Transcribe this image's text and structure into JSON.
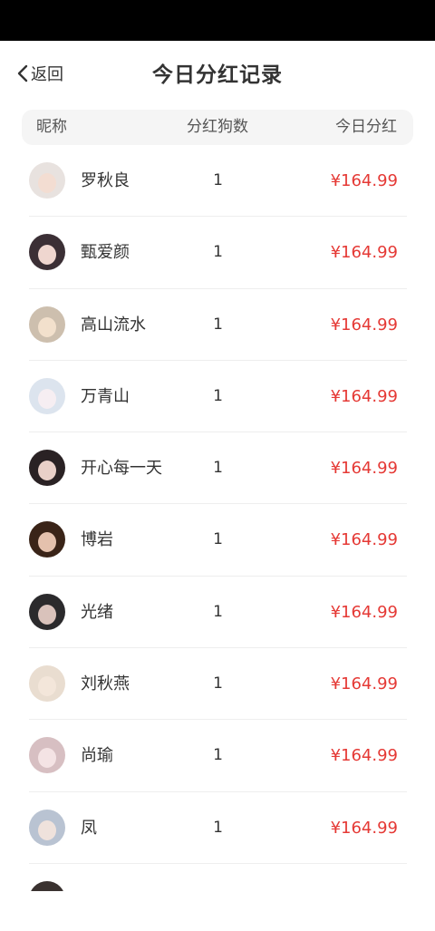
{
  "nav": {
    "back_label": "返回",
    "title": "今日分红记录"
  },
  "table": {
    "col_nickname": "昵称",
    "col_count": "分红狗数",
    "col_amount": "今日分红"
  },
  "rows": [
    {
      "name": "罗秋良",
      "count": "1",
      "amount": "¥164.99",
      "avatar_bg": "#e8e2df",
      "avatar_face": "#f3ddd2"
    },
    {
      "name": "甄爱颜",
      "count": "1",
      "amount": "¥164.99",
      "avatar_bg": "#3b2f35",
      "avatar_face": "#efd6cf"
    },
    {
      "name": "高山流水",
      "count": "1",
      "amount": "¥164.99",
      "avatar_bg": "#cdbfae",
      "avatar_face": "#f2e0cc"
    },
    {
      "name": "万青山",
      "count": "1",
      "amount": "¥164.99",
      "avatar_bg": "#dce4ee",
      "avatar_face": "#f6eef2"
    },
    {
      "name": "开心每一天",
      "count": "1",
      "amount": "¥164.99",
      "avatar_bg": "#2a2224",
      "avatar_face": "#e9d0c8"
    },
    {
      "name": "博岩",
      "count": "1",
      "amount": "¥164.99",
      "avatar_bg": "#3a2418",
      "avatar_face": "#e4c1ad"
    },
    {
      "name": "光绪",
      "count": "1",
      "amount": "¥164.99",
      "avatar_bg": "#2b2a2c",
      "avatar_face": "#d9c2bb"
    },
    {
      "name": "刘秋燕",
      "count": "1",
      "amount": "¥164.99",
      "avatar_bg": "#e9ddd0",
      "avatar_face": "#f3e6da"
    },
    {
      "name": "尚瑜",
      "count": "1",
      "amount": "¥164.99",
      "avatar_bg": "#d7bfc2",
      "avatar_face": "#f4e3e4"
    },
    {
      "name": "凤",
      "count": "1",
      "amount": "¥164.99",
      "avatar_bg": "#b9c3d2",
      "avatar_face": "#efe2dc"
    },
    {
      "name": "",
      "count": "",
      "amount": "",
      "avatar_bg": "#3a3230",
      "avatar_face": "#e2cfc8"
    }
  ],
  "colors": {
    "amount": "#e53935",
    "header_bg": "#f5f5f5"
  },
  "icons": {
    "back": "chevron-left-icon"
  }
}
